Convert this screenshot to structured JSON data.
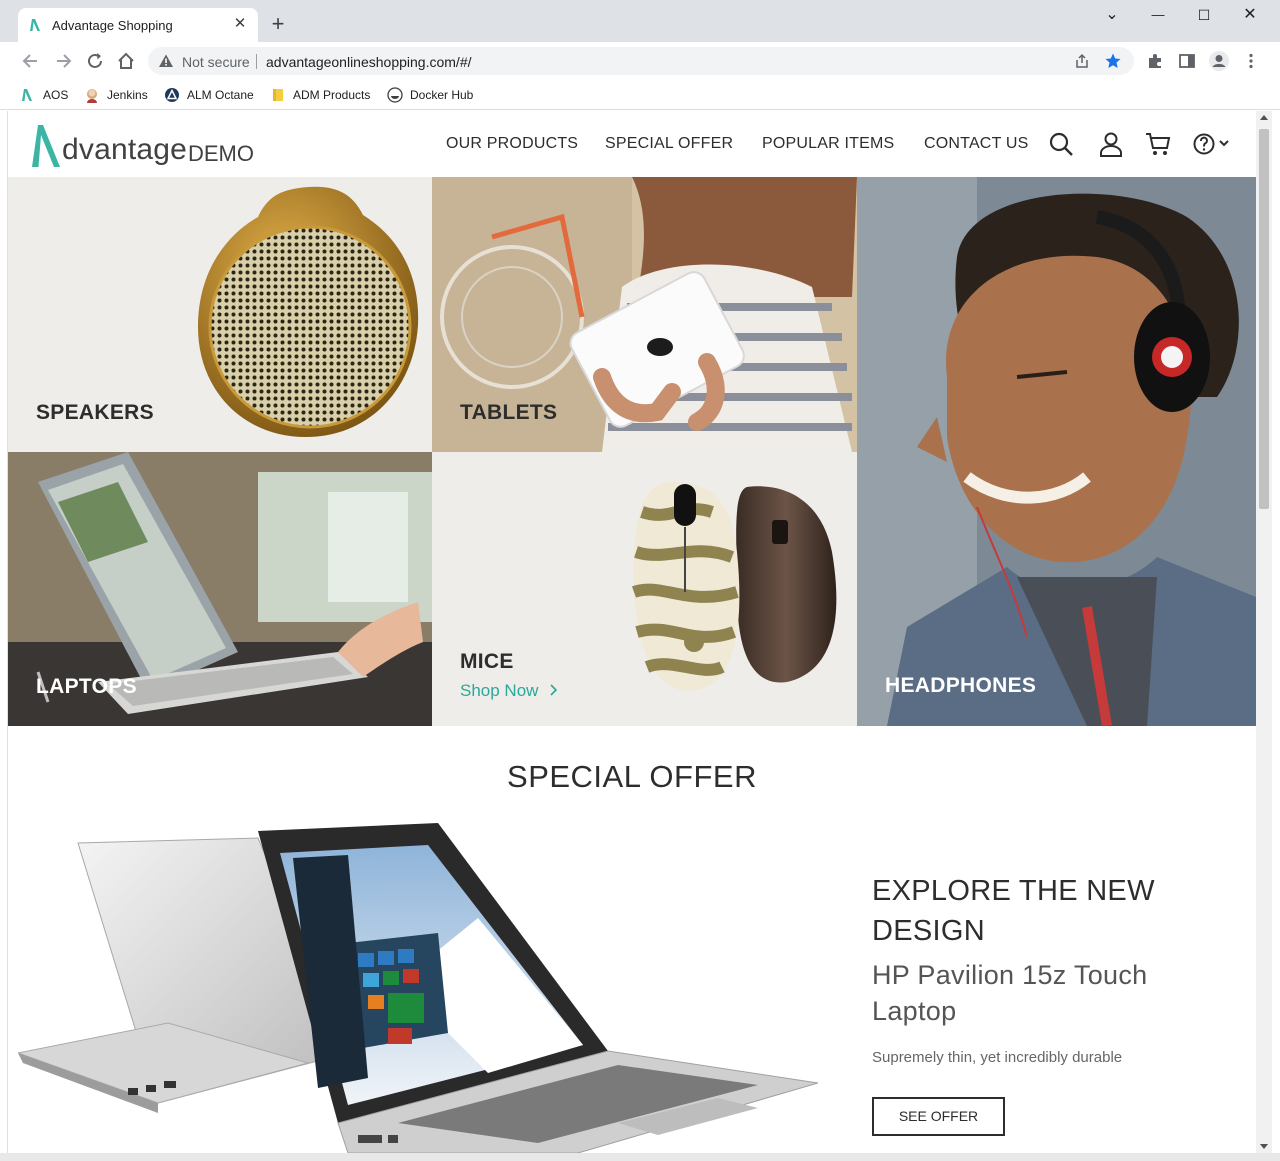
{
  "browser": {
    "tab_title": "Advantage Shopping",
    "tab_close": "✕",
    "new_tab": "+",
    "window_controls": {
      "chevron": "⌄",
      "minimize": "—",
      "maximize": "☐",
      "close": "✕"
    },
    "security_label": "Not secure",
    "url": "advantageonlineshopping.com/#/",
    "bookmarks": [
      {
        "label": "AOS",
        "icon": "aos-logo-icon"
      },
      {
        "label": "Jenkins",
        "icon": "jenkins-icon"
      },
      {
        "label": "ALM Octane",
        "icon": "octane-icon"
      },
      {
        "label": "ADM Products",
        "icon": "folder-icon"
      },
      {
        "label": "Docker Hub",
        "icon": "docker-icon"
      }
    ]
  },
  "site": {
    "logo_word": "dvantage",
    "logo_demo": "DEMO",
    "nav": [
      "OUR PRODUCTS",
      "SPECIAL OFFER",
      "POPULAR ITEMS",
      "CONTACT US"
    ],
    "icons": [
      "search-icon",
      "user-icon",
      "cart-icon",
      "help-icon"
    ],
    "accent_color": "#2aa89a"
  },
  "categories": {
    "speakers": "SPEAKERS",
    "tablets": "TABLETS",
    "headphones": "HEADPHONES",
    "laptops": "LAPTOPS",
    "mice": "MICE",
    "shop_now": "Shop Now"
  },
  "special_offer": {
    "section_title": "SPECIAL OFFER",
    "headline": "EXPLORE THE NEW DESIGN",
    "product": "HP Pavilion 15z Touch Laptop",
    "description": "Supremely thin, yet incredibly durable",
    "button": "SEE OFFER"
  }
}
